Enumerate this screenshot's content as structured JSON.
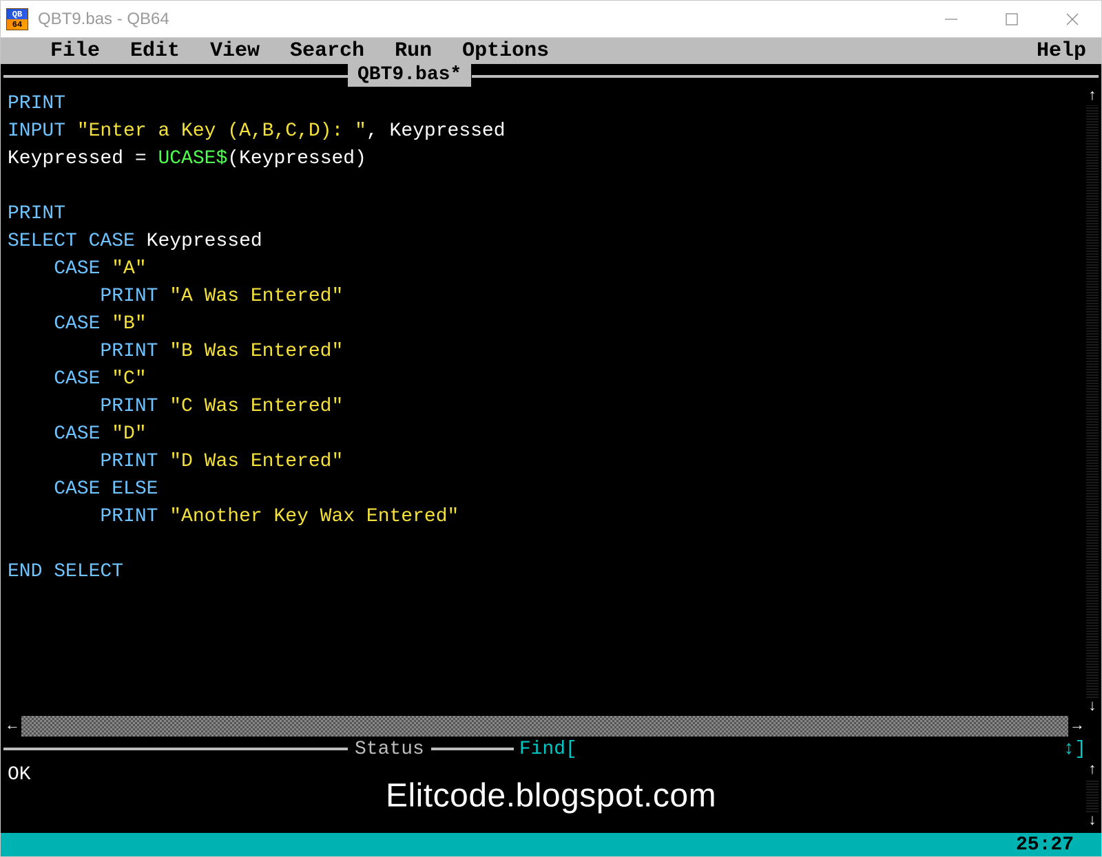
{
  "titlebar": {
    "title": "QBT9.bas - QB64",
    "icon_top": "QB",
    "icon_bot": "64"
  },
  "menu": {
    "items": [
      "File",
      "Edit",
      "View",
      "Search",
      "Run",
      "Options"
    ],
    "help": "Help"
  },
  "document": {
    "tab": "QBT9.bas*"
  },
  "code": {
    "lines": [
      {
        "tokens": [
          {
            "c": "kw",
            "t": "PRINT"
          }
        ]
      },
      {
        "tokens": [
          {
            "c": "kw",
            "t": "INPUT "
          },
          {
            "c": "str",
            "t": "\"Enter a Key (A,B,C,D): \""
          },
          {
            "c": "id",
            "t": ", Keypressed"
          }
        ]
      },
      {
        "tokens": [
          {
            "c": "id",
            "t": "Keypressed = "
          },
          {
            "c": "fn",
            "t": "UCASE$"
          },
          {
            "c": "id",
            "t": "(Keypressed)"
          }
        ]
      },
      {
        "tokens": [
          {
            "c": "id",
            "t": ""
          }
        ]
      },
      {
        "tokens": [
          {
            "c": "kw",
            "t": "PRINT"
          }
        ]
      },
      {
        "tokens": [
          {
            "c": "kw",
            "t": "SELECT CASE "
          },
          {
            "c": "id",
            "t": "Keypressed"
          }
        ]
      },
      {
        "indent": 1,
        "tokens": [
          {
            "c": "kw",
            "t": "CASE "
          },
          {
            "c": "str",
            "t": "\"A\""
          }
        ]
      },
      {
        "indent": 2,
        "tokens": [
          {
            "c": "kw",
            "t": "PRINT "
          },
          {
            "c": "str",
            "t": "\"A Was Entered\""
          }
        ]
      },
      {
        "indent": 1,
        "tokens": [
          {
            "c": "kw",
            "t": "CASE "
          },
          {
            "c": "str",
            "t": "\"B\""
          }
        ]
      },
      {
        "indent": 2,
        "tokens": [
          {
            "c": "kw",
            "t": "PRINT "
          },
          {
            "c": "str",
            "t": "\"B Was Entered\""
          }
        ]
      },
      {
        "indent": 1,
        "tokens": [
          {
            "c": "kw",
            "t": "CASE "
          },
          {
            "c": "str",
            "t": "\"C\""
          }
        ]
      },
      {
        "indent": 2,
        "tokens": [
          {
            "c": "kw",
            "t": "PRINT "
          },
          {
            "c": "str",
            "t": "\"C Was Entered\""
          }
        ]
      },
      {
        "indent": 1,
        "tokens": [
          {
            "c": "kw",
            "t": "CASE "
          },
          {
            "c": "str",
            "t": "\"D\""
          }
        ]
      },
      {
        "indent": 2,
        "tokens": [
          {
            "c": "kw",
            "t": "PRINT "
          },
          {
            "c": "str",
            "t": "\"D Was Entered\""
          }
        ]
      },
      {
        "indent": 1,
        "tokens": [
          {
            "c": "kw",
            "t": "CASE ELSE"
          }
        ]
      },
      {
        "indent": 2,
        "tokens": [
          {
            "c": "kw",
            "t": "PRINT "
          },
          {
            "c": "str",
            "t": "\"Another Key Wax Entered\""
          }
        ]
      },
      {
        "tokens": [
          {
            "c": "id",
            "t": ""
          }
        ]
      },
      {
        "tokens": [
          {
            "c": "kw",
            "t": "END SELECT"
          }
        ]
      }
    ]
  },
  "status": {
    "label": "Status",
    "find": "Find[",
    "arrows": "↕]",
    "ok": "OK"
  },
  "watermark": "Elitcode.blogspot.com",
  "bottombar": {
    "cursor_pos": "25:27"
  }
}
